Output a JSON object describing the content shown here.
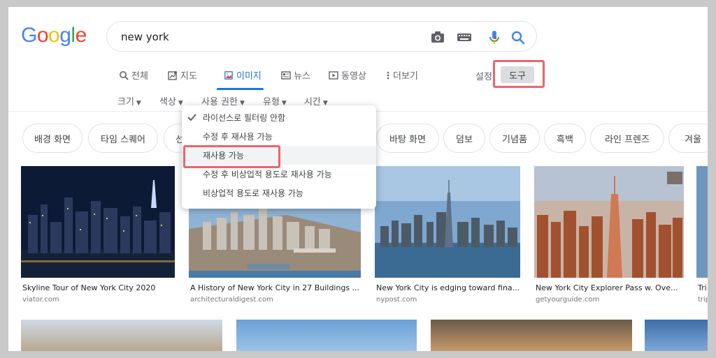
{
  "logo": {
    "letters": [
      "G",
      "o",
      "o",
      "g",
      "l",
      "e"
    ]
  },
  "search": {
    "value": "new york"
  },
  "tabs": [
    {
      "label": "전체",
      "icon": "search-icon"
    },
    {
      "label": "지도",
      "icon": "map-icon"
    },
    {
      "label": "이미지",
      "icon": "image-icon",
      "active": true
    },
    {
      "label": "뉴스",
      "icon": "news-icon"
    },
    {
      "label": "동영상",
      "icon": "video-icon"
    },
    {
      "label": "더보기",
      "icon": "more-icon"
    }
  ],
  "settings_label": "설정",
  "tools_label": "도구",
  "filters": [
    {
      "label": "크기"
    },
    {
      "label": "색상"
    },
    {
      "label": "사용 권한"
    },
    {
      "label": "유형"
    },
    {
      "label": "시간"
    }
  ],
  "chips": [
    "배경 화면",
    "타임 스퀘어",
    "선",
    "바탕 화면",
    "덤보",
    "기념품",
    "흑백",
    "라인 프렌즈",
    "겨울"
  ],
  "results": [
    {
      "caption": "Skyline Tour of New York City 2020",
      "domain": "viator.com"
    },
    {
      "caption": "A History of New York City in 27 Buildings ...",
      "domain": "architecturaldigest.com"
    },
    {
      "caption": "New York City is edging toward fina...",
      "domain": "nypost.com"
    },
    {
      "caption": "New York City Explorer Pass w. Ove...",
      "domain": "getyourguide.com"
    },
    {
      "caption": "Tri",
      "domain": "trip"
    }
  ],
  "license_menu": {
    "items": [
      {
        "label": "라이선스로 필터링 안함",
        "checked": true
      },
      {
        "label": "수정 후 재사용 가능"
      },
      {
        "label": "재사용 가능",
        "selected": true
      },
      {
        "label": "수정 후 비상업적 용도로 재사용 가능"
      },
      {
        "label": "비상업적 용도로 재사용 가능"
      }
    ]
  },
  "colors": {
    "accent": "#1a73e8",
    "highlight": "#f0636b"
  }
}
